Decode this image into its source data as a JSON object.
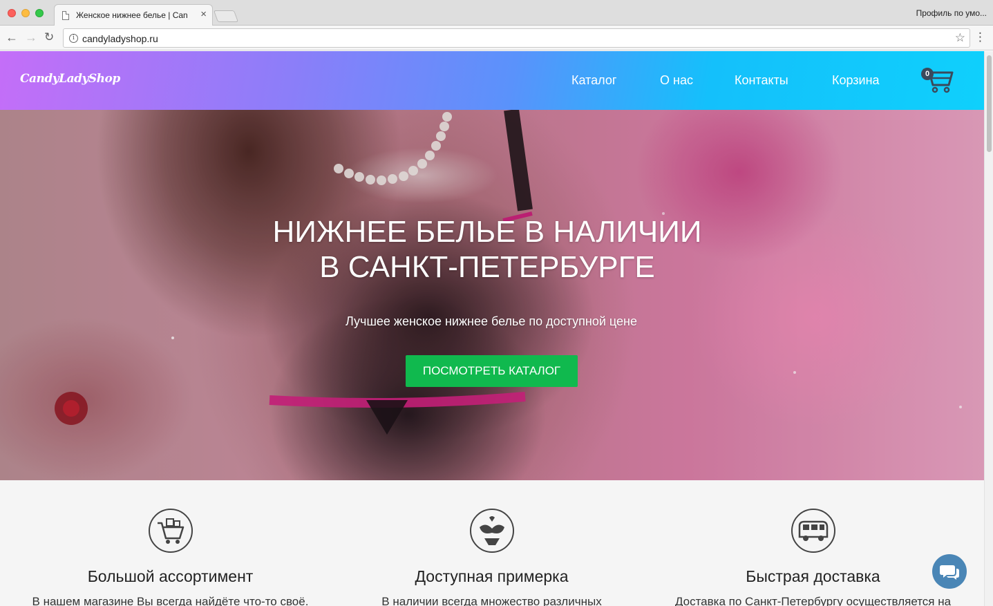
{
  "browser": {
    "tab_title": "Женское нижнее белье | Can",
    "tab_close": "×",
    "profile_label": "Профиль по умо...",
    "url": "candyladyshop.ru",
    "back_glyph": "←",
    "forward_glyph": "→",
    "reload_glyph": "↻",
    "info_glyph": "i",
    "star_glyph": "☆",
    "menu_glyph": "⋮",
    "icons": [
      "document-icon",
      "close-icon",
      "back-arrow-icon",
      "forward-arrow-icon",
      "reload-icon",
      "info-icon",
      "bookmark-star-icon",
      "menu-icon"
    ]
  },
  "header": {
    "logo": "CandyLadyShop",
    "nav": {
      "catalog": "Каталог",
      "about": "О нас",
      "contacts": "Контакты",
      "cart": "Корзина"
    },
    "cart_count": "0",
    "gradient": [
      "#c46ef8",
      "#5a92fb",
      "#0fd0fc"
    ]
  },
  "hero": {
    "title_line1": "НИЖНЕЕ БЕЛЬЕ В НАЛИЧИИ",
    "title_line2": "В САНКТ-ПЕТЕРБУРГЕ",
    "subtitle": "Лучшее женское нижнее белье по доступной цене",
    "cta": "ПОСМОТРЕТЬ КАТАЛОГ",
    "cta_color": "#10b94e"
  },
  "features": [
    {
      "icon": "shopping-cart-gifts-icon",
      "title": "Большой ассортимент",
      "text": "В нашем магазине Вы всегда найдёте что-то своё."
    },
    {
      "icon": "lingerie-set-icon",
      "title": "Доступная примерка",
      "text": "В наличии всегда множество различных"
    },
    {
      "icon": "delivery-van-icon",
      "title": "Быстрая доставка",
      "text": "Доставка по Санкт-Петербургу осуществляется на"
    }
  ],
  "chat": {
    "icon": "chat-bubbles-icon",
    "color": "#4a86b6"
  }
}
